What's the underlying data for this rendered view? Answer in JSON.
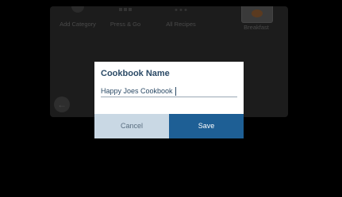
{
  "background_tiles": [
    {
      "label": "Add Category",
      "icon": "circle-icon"
    },
    {
      "label": "Press & Go",
      "icon": "grid-icon"
    },
    {
      "label": "All Recipes",
      "icon": "dots-icon"
    },
    {
      "label": "Breakfast",
      "icon": "food-photo"
    }
  ],
  "back_icon": "←",
  "dialog": {
    "title": "Cookbook Name",
    "input_value": "Happy Joes Cookbook",
    "cancel_label": "Cancel",
    "save_label": "Save"
  },
  "colors": {
    "accent": "#1e5f95",
    "cancel_bg": "#c9d8e4",
    "title_text": "#2b4a66",
    "overlay": "#000000"
  }
}
